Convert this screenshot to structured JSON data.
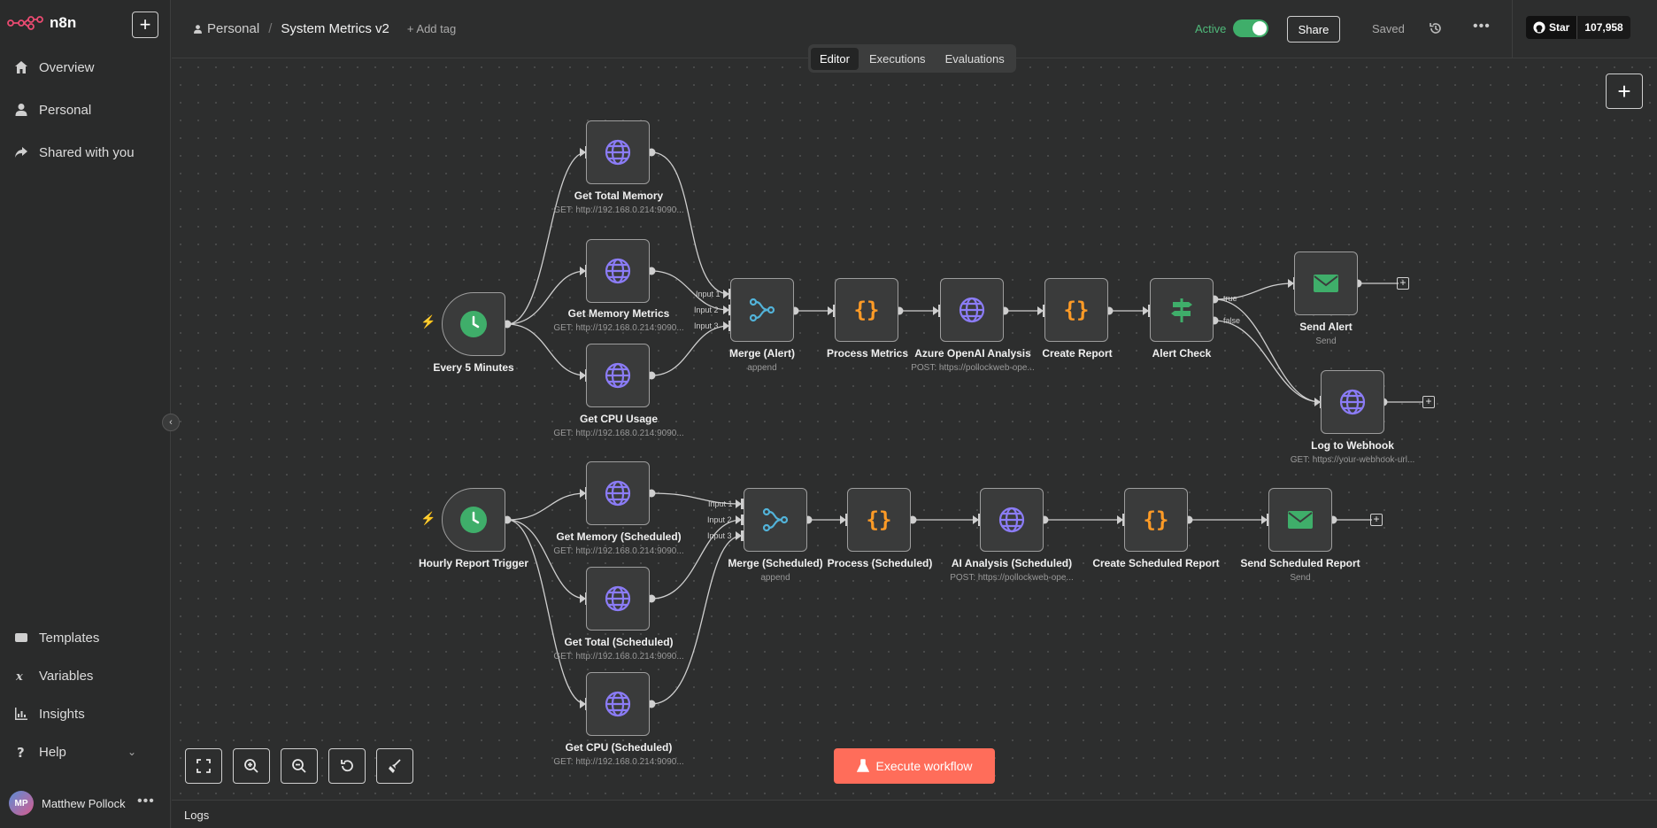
{
  "app": {
    "logo_text": "n8n"
  },
  "sidebar": {
    "new_label": "+",
    "top_items": [
      {
        "label": "Overview",
        "icon": "home-icon"
      },
      {
        "label": "Personal",
        "icon": "user-icon"
      },
      {
        "label": "Shared with you",
        "icon": "share-icon"
      }
    ],
    "bottom_items": [
      {
        "label": "Templates",
        "icon": "templates-icon"
      },
      {
        "label": "Variables",
        "icon": "variables-icon"
      },
      {
        "label": "Insights",
        "icon": "insights-icon"
      },
      {
        "label": "Help",
        "icon": "help-icon"
      }
    ],
    "user": {
      "initials": "MP",
      "name": "Matthew Pollock",
      "more": "•••"
    },
    "collapse": "‹"
  },
  "header": {
    "breadcrumb_parent": "Personal",
    "separator": "/",
    "workflow_name": "System Metrics v2",
    "add_tag": "+ Add tag",
    "active_label": "Active",
    "active": true,
    "share_label": "Share",
    "saved_label": "Saved",
    "more": "•••",
    "github": {
      "label": "Star",
      "count": "107,958"
    }
  },
  "tabs": [
    {
      "label": "Editor",
      "active": true
    },
    {
      "label": "Executions",
      "active": false
    },
    {
      "label": "Evaluations",
      "active": false
    }
  ],
  "nodes": {
    "every5": {
      "label": "Every 5 Minutes",
      "icon": "clock-icon"
    },
    "getTotalMemory": {
      "label": "Get Total Memory",
      "sub": "GET: http://192.168.0.214:9090...",
      "icon": "globe-icon"
    },
    "getMemoryMetrics": {
      "label": "Get Memory Metrics",
      "sub": "GET: http://192.168.0.214:9090...",
      "icon": "globe-icon"
    },
    "getCpuUsage": {
      "label": "Get CPU Usage",
      "sub": "GET: http://192.168.0.214:9090...",
      "icon": "globe-icon"
    },
    "mergeAlert": {
      "label": "Merge (Alert)",
      "sub": "append",
      "icon": "merge-icon",
      "inputs": [
        "Input 1",
        "Input 2",
        "Input 3"
      ]
    },
    "processMetrics": {
      "label": "Process Metrics",
      "icon": "code-icon"
    },
    "azureOpenAI": {
      "label": "Azure OpenAI Analysis",
      "sub": "POST: https://pollockweb-ope...",
      "icon": "globe-icon"
    },
    "createReport": {
      "label": "Create Report",
      "icon": "code-icon"
    },
    "alertCheck": {
      "label": "Alert Check",
      "icon": "if-icon",
      "outputs": [
        "true",
        "false"
      ]
    },
    "sendAlert": {
      "label": "Send Alert",
      "sub": "Send",
      "icon": "email-icon"
    },
    "logWebhook": {
      "label": "Log to Webhook",
      "sub": "GET: https://your-webhook-url...",
      "icon": "globe-icon"
    },
    "hourly": {
      "label": "Hourly Report Trigger",
      "icon": "clock-icon"
    },
    "getMemorySched": {
      "label": "Get Memory (Scheduled)",
      "sub": "GET: http://192.168.0.214:9090...",
      "icon": "globe-icon"
    },
    "getTotalSched": {
      "label": "Get Total (Scheduled)",
      "sub": "GET: http://192.168.0.214:9090...",
      "icon": "globe-icon"
    },
    "getCpuSched": {
      "label": "Get CPU (Scheduled)",
      "sub": "GET: http://192.168.0.214:9090...",
      "icon": "globe-icon"
    },
    "mergeSched": {
      "label": "Merge (Scheduled)",
      "sub": "append",
      "icon": "merge-icon",
      "inputs": [
        "Input 1",
        "Input 2",
        "Input 3"
      ]
    },
    "processSched": {
      "label": "Process (Scheduled)",
      "icon": "code-icon"
    },
    "aiSched": {
      "label": "AI Analysis (Scheduled)",
      "sub": "POST: https://pollockweb-ope...",
      "icon": "globe-icon"
    },
    "createSchedReport": {
      "label": "Create Scheduled Report",
      "icon": "code-icon"
    },
    "sendSchedReport": {
      "label": "Send Scheduled Report",
      "sub": "Send",
      "icon": "email-icon"
    }
  },
  "canvas": {
    "add_label": "+",
    "execute_label": "Execute workflow"
  },
  "colors": {
    "accent": "#ff6d5a",
    "active_green": "#3fae6a",
    "globe": "#8b7cf6",
    "code": "#ff9b26",
    "merge": "#52b3d9",
    "if_node": "#3fae6a",
    "email": "#3fae6a",
    "trigger": "#3fae6a"
  },
  "logs": {
    "label": "Logs"
  }
}
